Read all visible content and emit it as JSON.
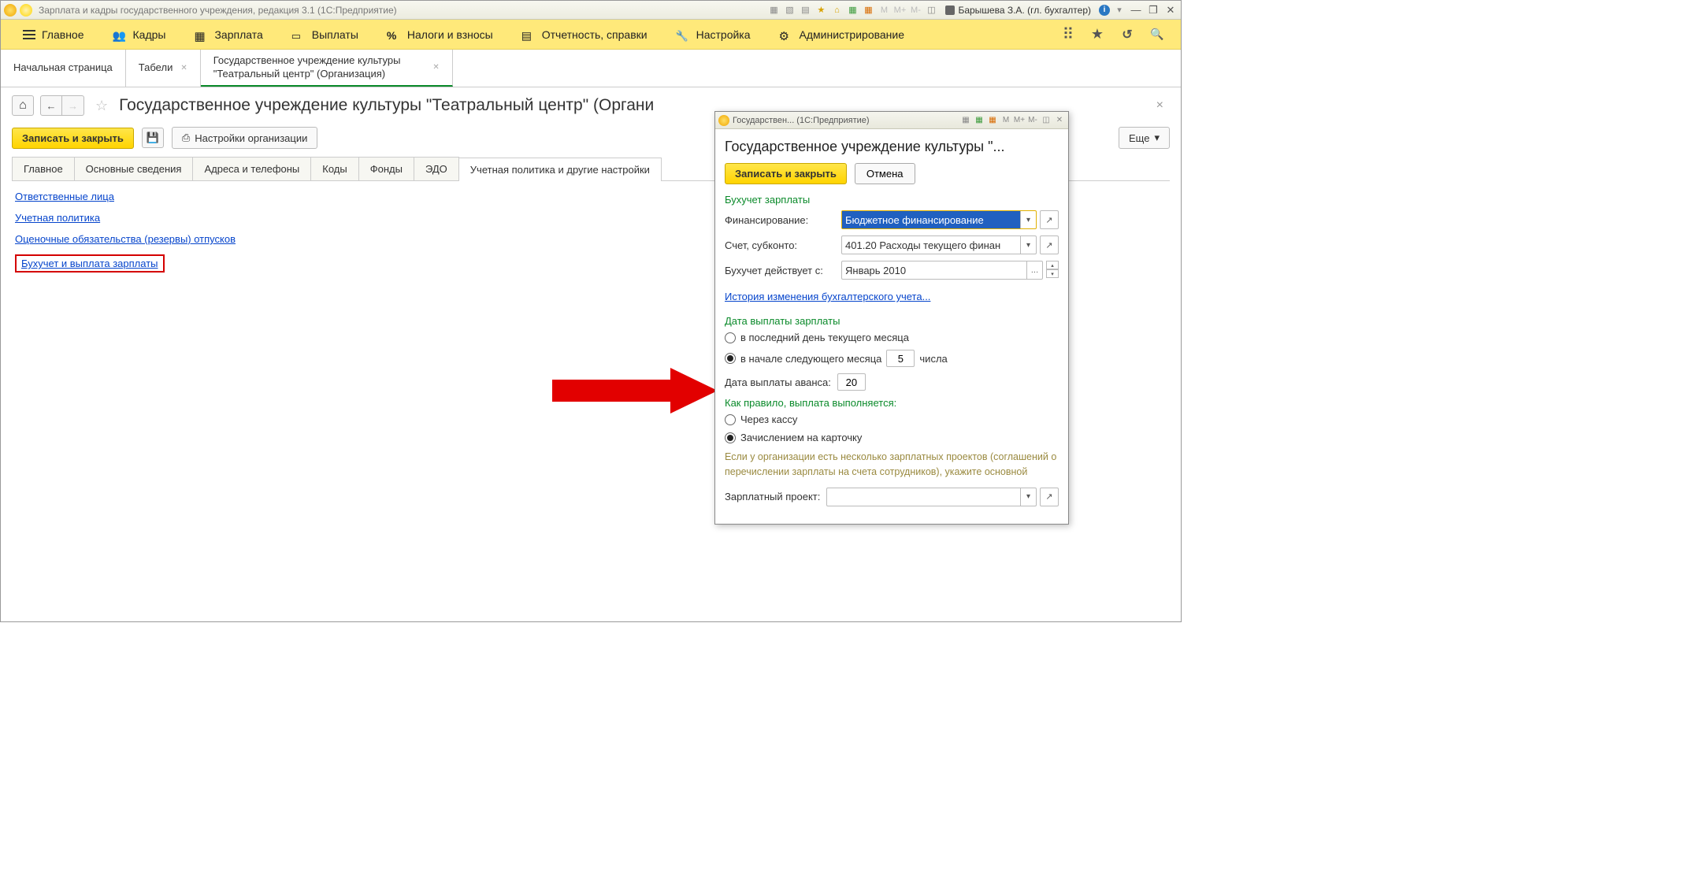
{
  "titlebar": {
    "title": "Зарплата и кадры государственного учреждения, редакция 3.1  (1С:Предприятие)",
    "user": "Барышева З.А. (гл. бухгалтер)",
    "mem_buttons": [
      "M",
      "M+",
      "M-"
    ]
  },
  "nav": {
    "items": [
      "Главное",
      "Кадры",
      "Зарплата",
      "Выплаты",
      "Налоги и взносы",
      "Отчетность, справки",
      "Настройка",
      "Администрирование"
    ]
  },
  "doctabs": {
    "start": "Начальная страница",
    "tab1": "Табели",
    "tab2": "Государственное учреждение культуры \"Театральный центр\" (Организация)"
  },
  "page": {
    "title": "Государственное учреждение культуры \"Театральный центр\" (Органи"
  },
  "toolbar": {
    "save_close": "Записать и закрыть",
    "org_settings": "Настройки организации",
    "more": "Еще"
  },
  "subtabs": {
    "t1": "Главное",
    "t2": "Основные сведения",
    "t3": "Адреса и телефоны",
    "t4": "Коды",
    "t5": "Фонды",
    "t6": "ЭДО",
    "t7": "Учетная политика и другие настройки"
  },
  "links": {
    "l1": "Ответственные лица",
    "l2": "Учетная политика",
    "l3": "Оценочные обязательства (резервы) отпусков",
    "l4": "Бухучет и выплата зарплаты"
  },
  "popup": {
    "wintitle": "Государствен... (1С:Предприятие)",
    "mem_buttons": [
      "M",
      "M+",
      "M-"
    ],
    "h1": "Государственное учреждение культуры \"...",
    "save_close": "Записать и закрыть",
    "cancel": "Отмена",
    "sec1": "Бухучет зарплаты",
    "financing_label": "Финансирование:",
    "financing_value": "Бюджетное финансирование",
    "account_label": "Счет, субконто:",
    "account_value": "401.20 Расходы текущего финан",
    "valid_from_label": "Бухучет действует с:",
    "valid_from_value": "Январь 2010",
    "history_link": "История изменения бухгалтерского учета...",
    "sec2": "Дата выплаты зарплаты",
    "radio_last": "в последний день текущего месяца",
    "radio_next": "в начале следующего месяца",
    "day_value": "5",
    "day_suffix": "числа",
    "advance_label": "Дата выплаты аванса:",
    "advance_value": "20",
    "sec3": "Как правило, выплата выполняется:",
    "radio_cash": "Через кассу",
    "radio_card": "Зачислением на карточку",
    "hint": "Если у организации есть несколько зарплатных проектов (соглашений о перечислении зарплаты на счета сотрудников), укажите основной",
    "project_label": "Зарплатный проект:",
    "project_value": ""
  }
}
